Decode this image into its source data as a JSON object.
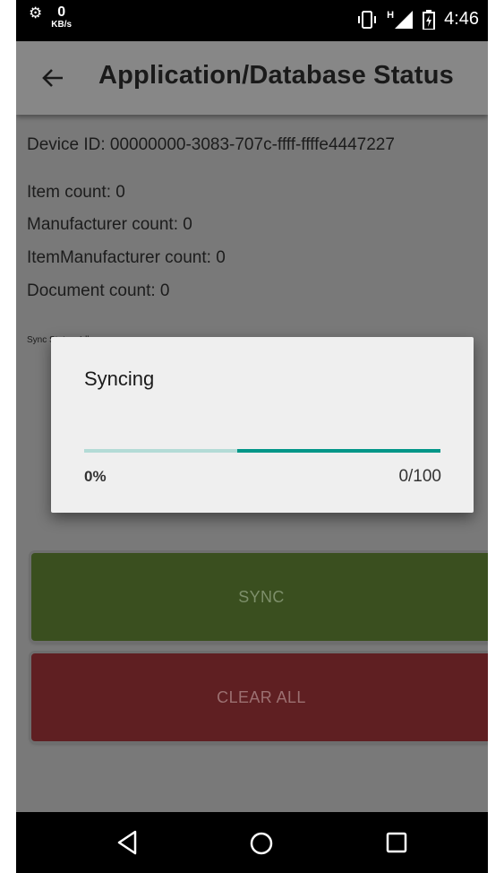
{
  "status_bar": {
    "network_speed_value": "0",
    "network_speed_unit": "KB/s",
    "network_type": "H",
    "time": "4:46"
  },
  "app_bar": {
    "title": "Application/Database Status"
  },
  "content": {
    "device_id": "Device ID: 00000000-3083-707c-ffff-ffffe4447227",
    "item_count": "Item count: 0",
    "manufacturer_count": "Manufacturer count: 0",
    "item_manufacturer_count": "ItemManufacturer count: 0",
    "document_count": "Document count: 0",
    "sync_status": "Sync Status: Idle"
  },
  "buttons": {
    "sync_label": "SYNC",
    "clear_all_label": "CLEAR ALL"
  },
  "dialog": {
    "title": "Syncing",
    "percent_text": "0%",
    "count_text": "0/100",
    "progress_fill_fraction": 0.57
  },
  "colors": {
    "progress_fill": "#009688",
    "progress_track": "#b3dbd6",
    "sync_button": "#3a4f1f",
    "clear_button": "#5f1f22"
  },
  "icons": {
    "back": "arrow-left-icon",
    "nav_back": "triangle-back-icon",
    "nav_home": "circle-home-icon",
    "nav_recents": "square-recents-icon"
  }
}
